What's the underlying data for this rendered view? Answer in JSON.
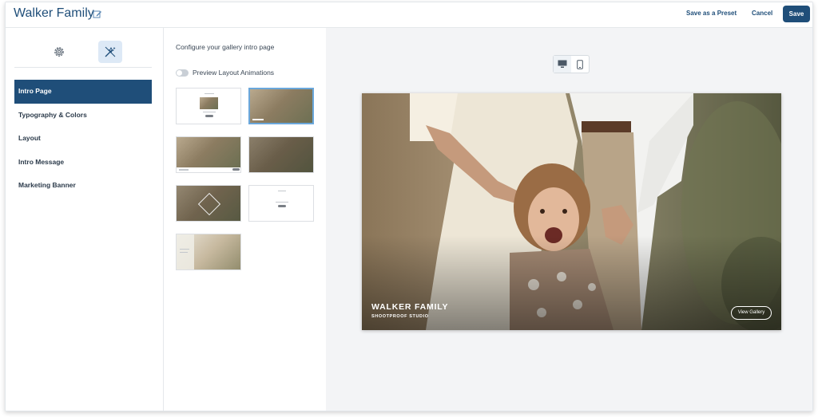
{
  "header": {
    "title": "Walker Family",
    "save_preset_label": "Save as a Preset",
    "cancel_label": "Cancel",
    "save_label": "Save"
  },
  "sidebar": {
    "items": [
      {
        "label": "Intro Page",
        "active": true
      },
      {
        "label": "Typography & Colors"
      },
      {
        "label": "Layout"
      },
      {
        "label": "Intro Message"
      },
      {
        "label": "Marketing Banner"
      }
    ]
  },
  "middle": {
    "configure_label": "Configure your gallery intro page",
    "toggle_label": "Preview Layout Animations"
  },
  "preview": {
    "title": "WALKER FAMILY",
    "subtitle": "SHOOTPROOF STUDIO",
    "button_label": "View Gallery"
  },
  "colors": {
    "accent": "#1f4e79",
    "selected_border": "#6aa7db",
    "active_tab_bg": "#dde9f6"
  },
  "icons": [
    "edit-icon",
    "gear-icon",
    "design-wand-icon",
    "desktop-icon",
    "mobile-icon"
  ]
}
